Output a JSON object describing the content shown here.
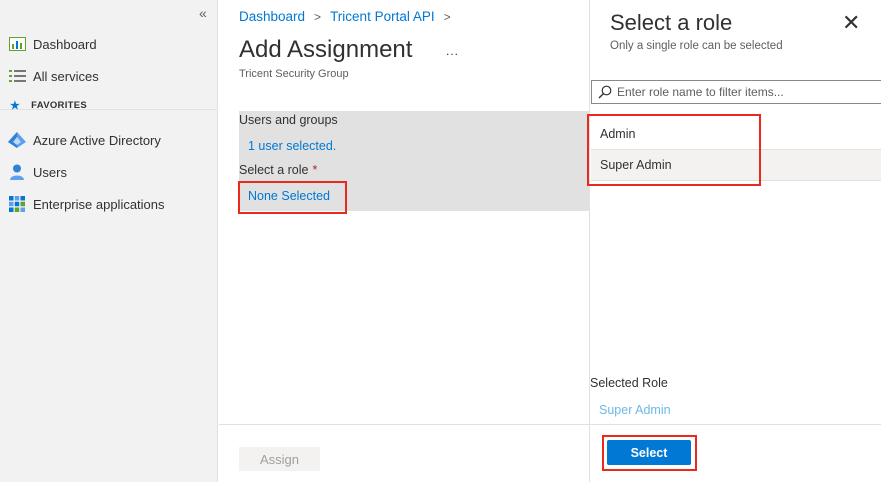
{
  "sidebar": {
    "collapse_glyph": "«",
    "items": [
      {
        "label": "Dashboard",
        "icon": "dashboard-icon"
      },
      {
        "label": "All services",
        "icon": "list-icon"
      }
    ],
    "favorites_label": "FAVORITES",
    "favorites": [
      {
        "label": "Azure Active Directory",
        "icon": "aad-icon"
      },
      {
        "label": "Users",
        "icon": "user-icon"
      },
      {
        "label": "Enterprise applications",
        "icon": "apps-grid-icon"
      }
    ]
  },
  "main": {
    "breadcrumb": [
      "Dashboard",
      "Tricent Portal API"
    ],
    "breadcrumb_sep": ">",
    "title": "Add Assignment",
    "more": "...",
    "subtitle": "Tricent Security Group",
    "users_groups_label": "Users and groups",
    "users_selected": "1 user selected.",
    "role_label": "Select a role",
    "required_mark": "*",
    "role_value": "None Selected",
    "assign_button": "Assign"
  },
  "panel": {
    "title": "Select a role",
    "subtitle": "Only a single role can be selected",
    "close": "✕",
    "filter_placeholder": "Enter role name to filter items...",
    "roles": [
      "Admin",
      "Super Admin"
    ],
    "selected_index": 1,
    "selected_role_label": "Selected Role",
    "selected_role_value": "Super Admin",
    "select_button": "Select"
  },
  "colors": {
    "accent": "#0078d4",
    "highlight_box": "#e8291c",
    "sidebar_bg": "#f2f2f2",
    "form_bg": "#e1e1e1"
  }
}
